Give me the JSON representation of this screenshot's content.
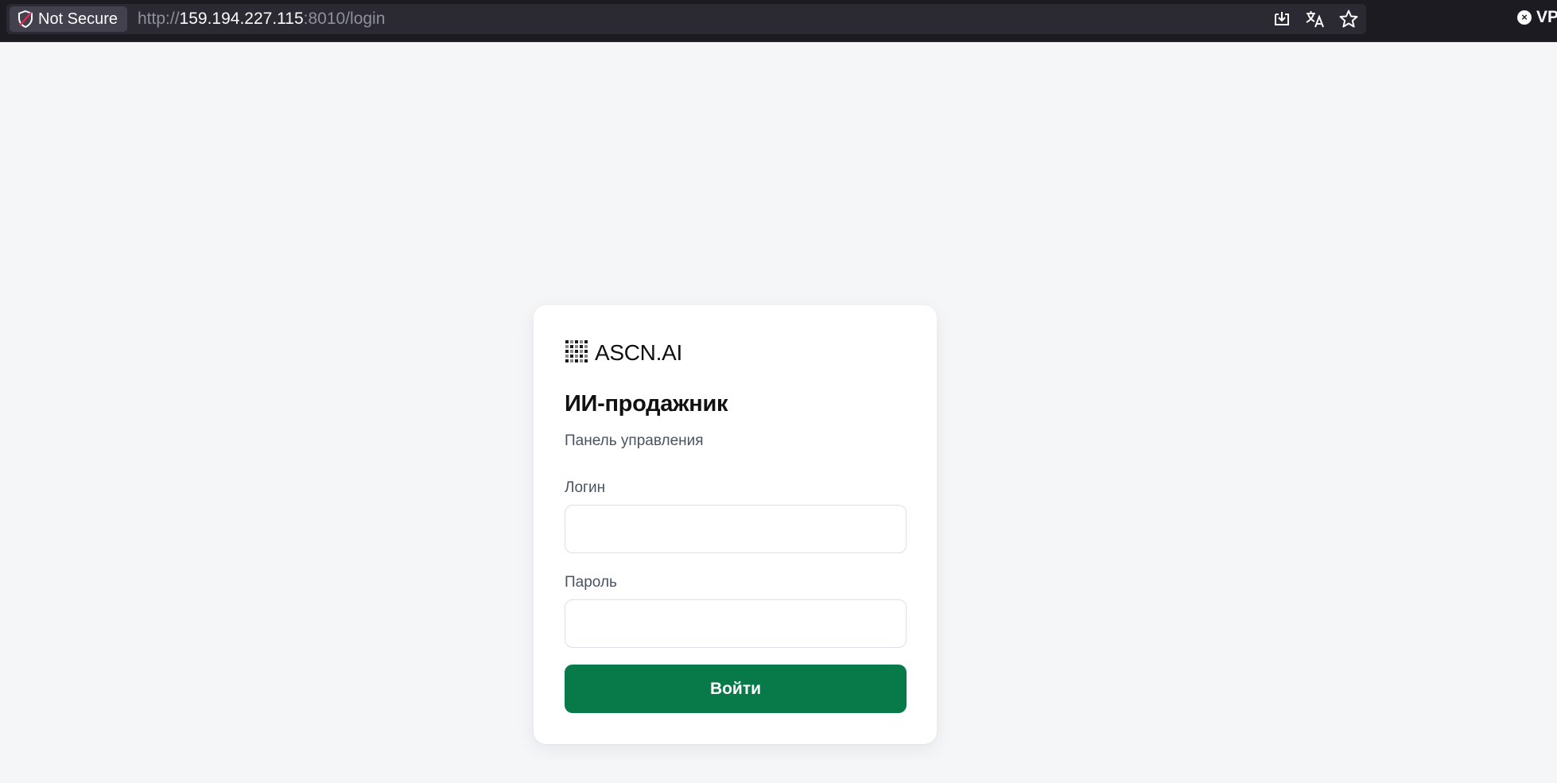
{
  "browser": {
    "security_label": "Not Secure",
    "url_scheme": "http://",
    "url_host": "159.194.227.115",
    "url_rest": ":8010/login",
    "vpn_label": "VP",
    "icons": [
      "shield-warning-icon",
      "download-icon",
      "translate-icon",
      "bookmark-star-icon",
      "close-circle-icon"
    ]
  },
  "login": {
    "brand_name": "ASCN.AI",
    "brand_icon": "grid-logo-icon",
    "title": "ИИ-продажник",
    "subtitle": "Панель управления",
    "username_label": "Логин",
    "username_value": "",
    "password_label": "Пароль",
    "password_value": "",
    "submit_label": "Войти",
    "accent_color": "#087a49"
  }
}
